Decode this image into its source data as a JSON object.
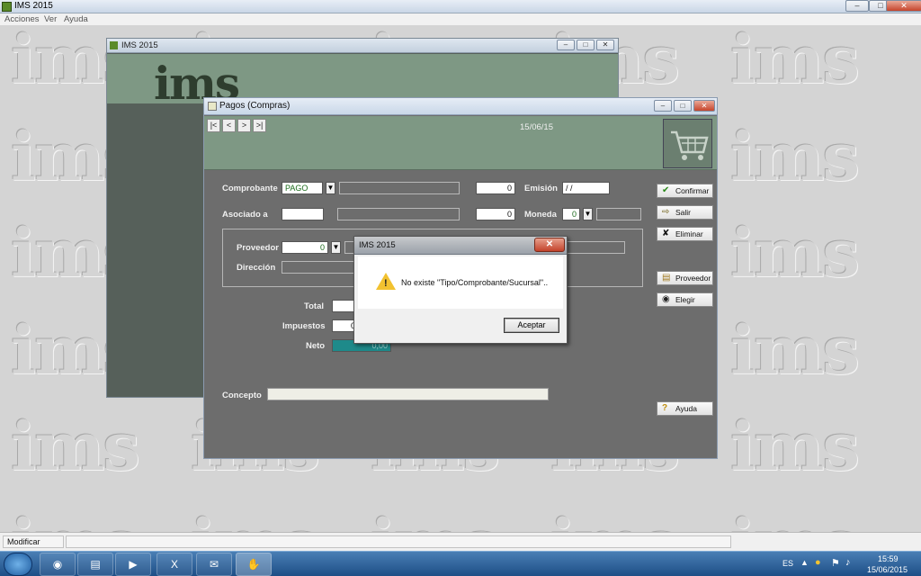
{
  "app": {
    "title": "IMS 2015"
  },
  "menu": [
    "Acciones",
    "Ver",
    "Ayuda"
  ],
  "watermark_text": "ims",
  "bg_window": {
    "title": "IMS 2015",
    "logo": "ims"
  },
  "pagos": {
    "title": "Pagos (Compras)",
    "nav": [
      "|<",
      "<",
      ">",
      ">|"
    ],
    "date": "15/06/15",
    "comprobante_label": "Comprobante",
    "comprobante_value": "PAGO",
    "comprobante_num": "0",
    "emision_label": "Emisión",
    "emision_value": " /  /",
    "asociado_label": "Asociado a",
    "asociado_num": "0",
    "moneda_label": "Moneda",
    "moneda_value": "0",
    "proveedor_label": "Proveedor",
    "proveedor_value": "0",
    "direccion_label": "Dirección",
    "total_label": "Total",
    "impuestos_label": "Impuestos",
    "impuestos_value": "0",
    "neto_label": "Neto",
    "neto_value": "0,00",
    "concepto_label": "Concepto",
    "buttons": {
      "confirmar": "Confirmar",
      "salir": "Salir",
      "eliminar": "Eliminar",
      "proveedor": "Proveedor",
      "elegir": "Elegir",
      "ayuda": "Ayuda"
    }
  },
  "dialog": {
    "title": "IMS 2015",
    "message": "No existe \"Tipo/Comprobante/Sucursal\"..",
    "ok": "Aceptar"
  },
  "statusbar": {
    "mode": "Modificar"
  },
  "tray": {
    "lang": "ES",
    "time": "15:59",
    "date": "15/06/2015"
  },
  "icons": [
    "window-icon",
    "cart-icon",
    "warning-icon",
    "check-icon",
    "exit-icon",
    "delete-icon",
    "folder-icon",
    "binoculars-icon",
    "help-icon",
    "start-icon",
    "firefox-icon",
    "explorer-icon",
    "media-icon",
    "excel-icon",
    "app-icon"
  ]
}
